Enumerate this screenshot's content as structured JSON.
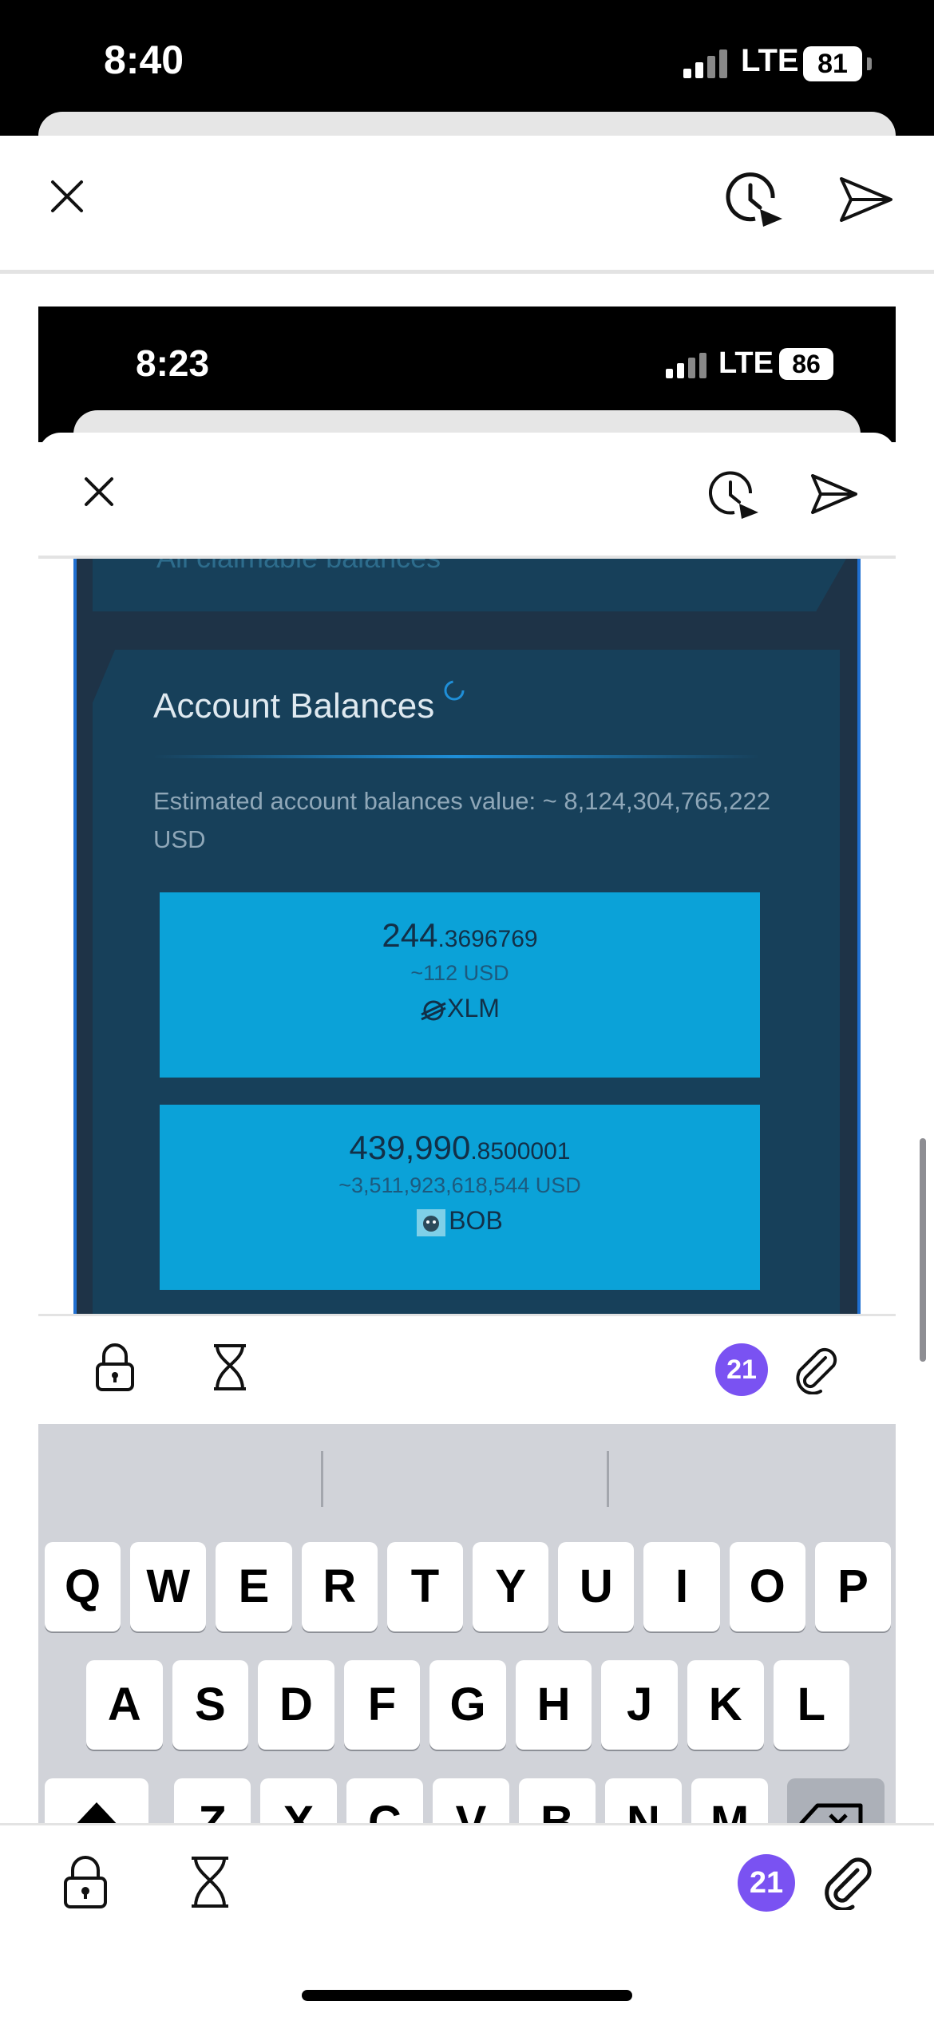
{
  "outer": {
    "status": {
      "time": "8:40",
      "network": "LTE",
      "battery": "81"
    },
    "badge_count": "21"
  },
  "inner": {
    "status": {
      "time": "8:23",
      "network": "LTE",
      "battery": "86"
    },
    "partial_link": "All claimable balances",
    "account_balances": {
      "title": "Account Balances",
      "estimated_label": "Estimated account balances value: ~ 8,124,304,765,222",
      "estimated_unit": "USD",
      "items": [
        {
          "amount_main": "244",
          "amount_decimal": ".3696769",
          "usd": "~112 USD",
          "asset": "XLM"
        },
        {
          "amount_main": "439,990",
          "amount_decimal": ".8500001",
          "usd": "~3,511,923,618,544 USD",
          "asset": "BOB"
        }
      ]
    },
    "badge_count": "21",
    "keyboard": {
      "row1": [
        "Q",
        "W",
        "E",
        "R",
        "T",
        "Y",
        "U",
        "I",
        "O",
        "P"
      ],
      "row2": [
        "A",
        "S",
        "D",
        "F",
        "G",
        "H",
        "J",
        "K",
        "L"
      ],
      "row3": [
        "Z",
        "X",
        "C",
        "V",
        "B",
        "N",
        "M"
      ]
    }
  },
  "colors": {
    "accent": "#7a52f2",
    "balance_box": "#0ba2d8",
    "panel": "#1e3347"
  }
}
